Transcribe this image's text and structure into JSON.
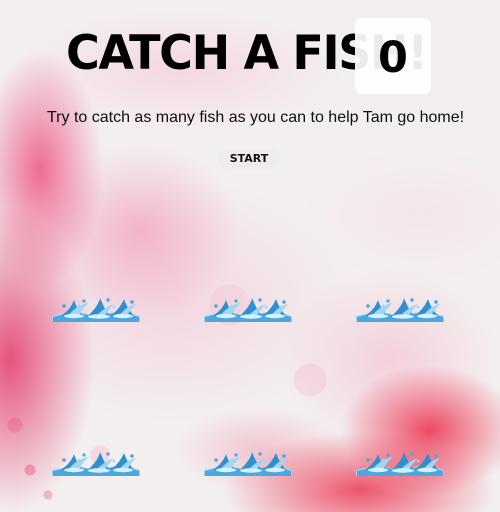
{
  "game": {
    "title": "CATCH A FISH!",
    "score": "0",
    "subtitle": "Try to catch as many fish as you can to help Tam go home!",
    "start_label": "START"
  },
  "board": {
    "holes": [
      {
        "icon": "water-splash-icon"
      },
      {
        "icon": "water-splash-icon"
      },
      {
        "icon": "water-splash-icon"
      },
      {
        "icon": "water-splash-icon"
      },
      {
        "icon": "water-splash-icon"
      },
      {
        "icon": "water-splash-icon"
      }
    ]
  },
  "colors": {
    "background": "#f3efef",
    "accent_red": "#ea2646",
    "accent_pink": "#f07ca4",
    "water_blue": "#4aa8de"
  }
}
